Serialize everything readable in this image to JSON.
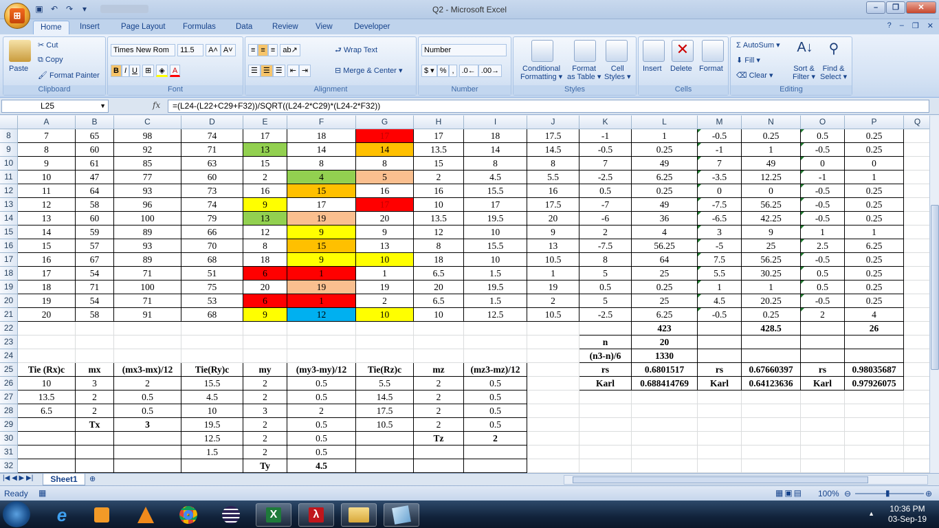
{
  "window": {
    "title": "Q2 - Microsoft Excel"
  },
  "tabs": [
    "Home",
    "Insert",
    "Page Layout",
    "Formulas",
    "Data",
    "Review",
    "View",
    "Developer"
  ],
  "ribbon": {
    "clipboard": {
      "label": "Clipboard",
      "paste": "Paste",
      "cut": "Cut",
      "copy": "Copy",
      "format_painter": "Format Painter"
    },
    "font": {
      "label": "Font",
      "name": "Times New Rom",
      "size": "11.5"
    },
    "alignment": {
      "label": "Alignment",
      "wrap": "Wrap Text",
      "merge": "Merge & Center"
    },
    "number": {
      "label": "Number",
      "format": "Number"
    },
    "styles": {
      "label": "Styles",
      "cond1": "Conditional",
      "cond2": "Formatting",
      "fmt1": "Format",
      "fmt2": "as Table",
      "cell1": "Cell",
      "cell2": "Styles"
    },
    "cells": {
      "label": "Cells",
      "insert": "Insert",
      "delete": "Delete",
      "format": "Format"
    },
    "editing": {
      "label": "Editing",
      "autosum": "AutoSum",
      "fill": "Fill",
      "clear": "Clear",
      "sort1": "Sort &",
      "sort2": "Filter",
      "find1": "Find &",
      "find2": "Select"
    }
  },
  "formula_bar": {
    "name_box": "L25",
    "formula": "=(L24-(L22+C29+F32))/SQRT((L24-2*C29)*(L24-2*F32))"
  },
  "columns": [
    "A",
    "B",
    "C",
    "D",
    "E",
    "F",
    "G",
    "H",
    "I",
    "J",
    "K",
    "L",
    "M",
    "N",
    "O",
    "P",
    "Q"
  ],
  "row_numbers": [
    8,
    9,
    10,
    11,
    12,
    13,
    14,
    15,
    16,
    17,
    18,
    19,
    20,
    21,
    22,
    23,
    24,
    25,
    26,
    27,
    28,
    29,
    30,
    31,
    32
  ],
  "rows": [
    [
      "7",
      "65",
      "98",
      "74",
      "17",
      "18",
      "17",
      "17",
      "18",
      "17.5",
      "-1",
      "1",
      "-0.5",
      "0.25",
      "0.5",
      "0.25"
    ],
    [
      "8",
      "60",
      "92",
      "71",
      "13",
      "14",
      "14",
      "13.5",
      "14",
      "14.5",
      "-0.5",
      "0.25",
      "-1",
      "1",
      "-0.5",
      "0.25"
    ],
    [
      "9",
      "61",
      "85",
      "63",
      "15",
      "8",
      "8",
      "15",
      "8",
      "8",
      "7",
      "49",
      "7",
      "49",
      "0",
      "0"
    ],
    [
      "10",
      "47",
      "77",
      "60",
      "2",
      "4",
      "5",
      "2",
      "4.5",
      "5.5",
      "-2.5",
      "6.25",
      "-3.5",
      "12.25",
      "-1",
      "1"
    ],
    [
      "11",
      "64",
      "93",
      "73",
      "16",
      "15",
      "16",
      "16",
      "15.5",
      "16",
      "0.5",
      "0.25",
      "0",
      "0",
      "-0.5",
      "0.25"
    ],
    [
      "12",
      "58",
      "96",
      "74",
      "9",
      "17",
      "17",
      "10",
      "17",
      "17.5",
      "-7",
      "49",
      "-7.5",
      "56.25",
      "-0.5",
      "0.25"
    ],
    [
      "13",
      "60",
      "100",
      "79",
      "13",
      "19",
      "20",
      "13.5",
      "19.5",
      "20",
      "-6",
      "36",
      "-6.5",
      "42.25",
      "-0.5",
      "0.25"
    ],
    [
      "14",
      "59",
      "89",
      "66",
      "12",
      "9",
      "9",
      "12",
      "10",
      "9",
      "2",
      "4",
      "3",
      "9",
      "1",
      "1"
    ],
    [
      "15",
      "57",
      "93",
      "70",
      "8",
      "15",
      "13",
      "8",
      "15.5",
      "13",
      "-7.5",
      "56.25",
      "-5",
      "25",
      "2.5",
      "6.25"
    ],
    [
      "16",
      "67",
      "89",
      "68",
      "18",
      "9",
      "10",
      "18",
      "10",
      "10.5",
      "8",
      "64",
      "7.5",
      "56.25",
      "-0.5",
      "0.25"
    ],
    [
      "17",
      "54",
      "71",
      "51",
      "6",
      "1",
      "1",
      "6.5",
      "1.5",
      "1",
      "5",
      "25",
      "5.5",
      "30.25",
      "0.5",
      "0.25"
    ],
    [
      "18",
      "71",
      "100",
      "75",
      "20",
      "19",
      "19",
      "20",
      "19.5",
      "19",
      "0.5",
      "0.25",
      "1",
      "1",
      "0.5",
      "0.25"
    ],
    [
      "19",
      "54",
      "71",
      "53",
      "6",
      "1",
      "2",
      "6.5",
      "1.5",
      "2",
      "5",
      "25",
      "4.5",
      "20.25",
      "-0.5",
      "0.25"
    ],
    [
      "20",
      "58",
      "91",
      "68",
      "9",
      "12",
      "10",
      "10",
      "12.5",
      "10.5",
      "-2.5",
      "6.25",
      "-0.5",
      "0.25",
      "2",
      "4"
    ]
  ],
  "fills": {
    "red": "#ff0000",
    "orange": "#ffc000",
    "yellow": "#ffff00",
    "green": "#92d050",
    "peach": "#fabf8f",
    "blue": "#00b0f0"
  },
  "row22": {
    "L": "423",
    "N": "428.5",
    "P": "26"
  },
  "row23": {
    "K": "n",
    "L": "20"
  },
  "row24": {
    "K": "(n3-n)/6",
    "L": "1330"
  },
  "row25": {
    "A": "Tie (Rx)c",
    "B": "mx",
    "C": "(mx3-mx)/12",
    "D": "Tie(Ry)c",
    "E": "my",
    "F": "(my3-my)/12",
    "G": "Tie(Rz)c",
    "H": "mz",
    "I": "(mz3-mz)/12",
    "K": "rs",
    "L": "0.6801517",
    "M": "rs",
    "N": "0.67660397",
    "O": "rs",
    "P": "0.98035687"
  },
  "row26": {
    "A": "10",
    "B": "3",
    "C": "2",
    "D": "15.5",
    "E": "2",
    "F": "0.5",
    "G": "5.5",
    "H": "2",
    "I": "0.5",
    "K": "Karl",
    "L": "0.688414769",
    "M": "Karl",
    "N": "0.64123636",
    "O": "Karl",
    "P": "0.97926075"
  },
  "row27": {
    "A": "13.5",
    "B": "2",
    "C": "0.5",
    "D": "4.5",
    "E": "2",
    "F": "0.5",
    "G": "14.5",
    "H": "2",
    "I": "0.5"
  },
  "row28": {
    "A": "6.5",
    "B": "2",
    "C": "0.5",
    "D": "10",
    "E": "3",
    "F": "2",
    "G": "17.5",
    "H": "2",
    "I": "0.5"
  },
  "row29": {
    "B": "Tx",
    "C": "3",
    "D": "19.5",
    "E": "2",
    "F": "0.5",
    "G": "10.5",
    "H": "2",
    "I": "0.5"
  },
  "row30": {
    "D": "12.5",
    "E": "2",
    "F": "0.5",
    "H": "Tz",
    "I": "2"
  },
  "row31": {
    "D": "1.5",
    "E": "2",
    "F": "0.5"
  },
  "row32": {
    "E": "Ty",
    "F": "4.5"
  },
  "sheet_tab": "Sheet1",
  "status": {
    "ready": "Ready",
    "zoom": "100%"
  },
  "taskbar": {
    "time": "10:36 PM",
    "date": "03-Sep-19"
  }
}
